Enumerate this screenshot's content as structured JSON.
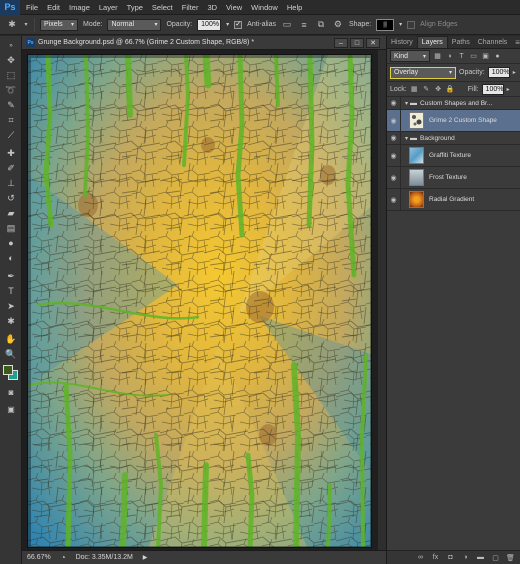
{
  "app": {
    "logo": "Ps"
  },
  "menu": [
    "File",
    "Edit",
    "Image",
    "Layer",
    "Type",
    "Select",
    "Filter",
    "3D",
    "View",
    "Window",
    "Help"
  ],
  "options": {
    "tool_icon": "custom-shape-icon",
    "pixels_select": "Pixels",
    "mode_label": "Mode:",
    "mode_value": "Normal",
    "opacity_label": "Opacity:",
    "opacity_value": "100%",
    "antialias_label": "Anti-alias",
    "antialias_checked": "✓",
    "shape_label": "Shape:",
    "align_edges_label": "Align Edges"
  },
  "document": {
    "title": "Grunge Background.psd @ 66.7% (Grime 2 Custom Shape, RGB/8) *",
    "zoom": "66.67%",
    "doc_size": "Doc: 3.35M/13.2M"
  },
  "colors": {
    "foreground": "#3c5a1a",
    "background": "#1fa08e",
    "selection_highlight": "#e0d040"
  },
  "panel": {
    "tabs": [
      "History",
      "Layers",
      "Paths",
      "Channels"
    ],
    "active_tab": "Layers",
    "filter_kind": "Kind",
    "blend_mode": "Overlay",
    "opacity_label": "Opacity:",
    "opacity_value": "100%",
    "lock_label": "Lock:",
    "fill_label": "Fill:",
    "fill_value": "100%",
    "layers": [
      {
        "name": "Custom Shapes and Br...",
        "type": "group"
      },
      {
        "name": "Grime 2 Custom Shape",
        "type": "layer",
        "selected": true
      },
      {
        "name": "Background",
        "type": "group"
      },
      {
        "name": "Graffiti Texture",
        "type": "layer"
      },
      {
        "name": "Frost Texture",
        "type": "layer"
      },
      {
        "name": "Radial Gradient",
        "type": "layer"
      }
    ]
  }
}
